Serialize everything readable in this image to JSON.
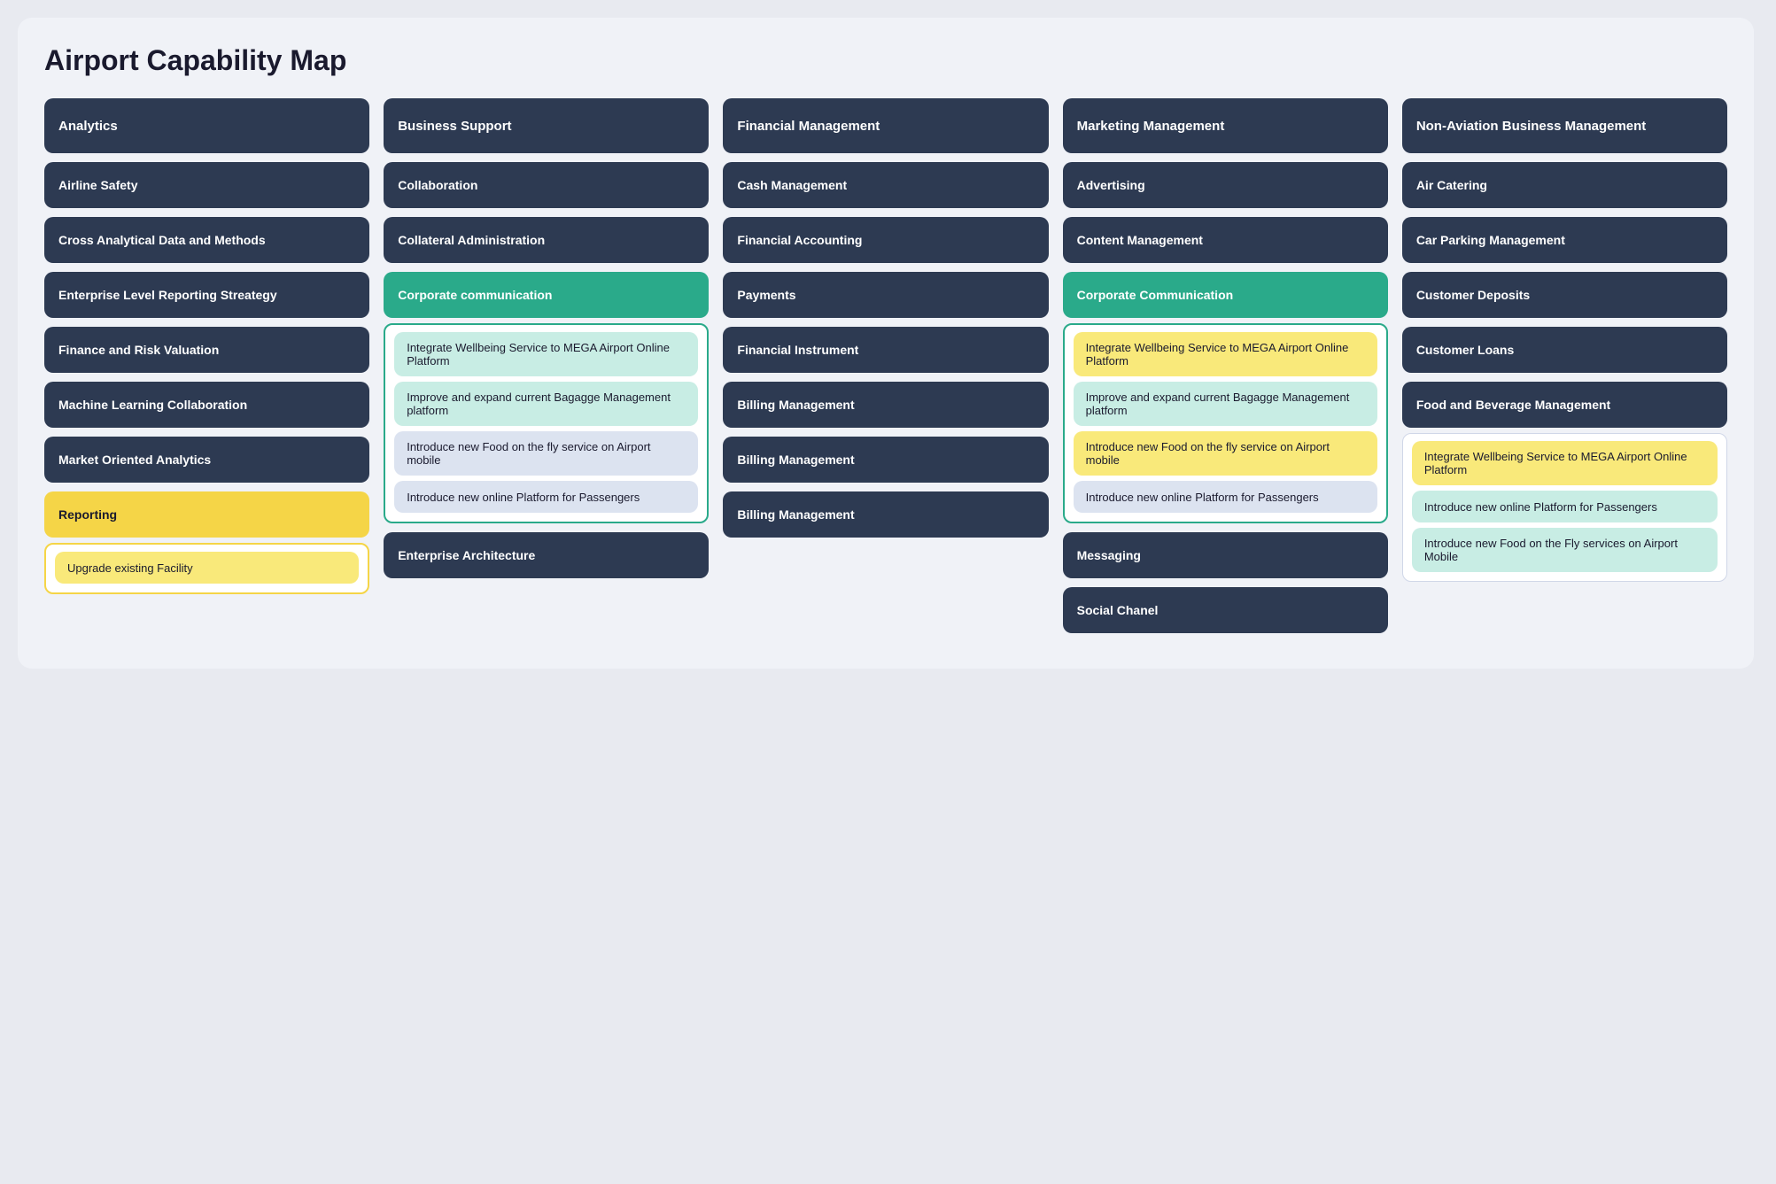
{
  "title": "Airport Capability Map",
  "columns": [
    {
      "id": "analytics",
      "header": "Analytics",
      "sections": [
        {
          "type": "card",
          "label": "Airline Safety"
        },
        {
          "type": "card",
          "label": "Cross Analytical Data and Methods"
        },
        {
          "type": "card",
          "label": "Enterprise Level Reporting Streategy"
        },
        {
          "type": "card",
          "label": "Finance and Risk Valuation"
        },
        {
          "type": "card",
          "label": "Machine Learning Collaboration"
        },
        {
          "type": "card",
          "label": "Market Oriented Analytics"
        },
        {
          "type": "group",
          "variant": "yellow",
          "label": "Reporting",
          "items": [
            {
              "variant": "light-yellow",
              "text": "Upgrade existing Facility"
            }
          ]
        }
      ]
    },
    {
      "id": "business-support",
      "header": "Business Support",
      "sections": [
        {
          "type": "card",
          "label": "Collaboration"
        },
        {
          "type": "card",
          "label": "Collateral Administration"
        },
        {
          "type": "group",
          "variant": "teal",
          "label": "Corporate communication",
          "items": [
            {
              "variant": "light-teal",
              "text": "Integrate Wellbeing Service to MEGA Airport Online Platform"
            },
            {
              "variant": "light-teal",
              "text": "Improve and expand current Bagagge Management platform"
            },
            {
              "variant": "light",
              "text": "Introduce new Food on the fly service on Airport mobile"
            },
            {
              "variant": "light",
              "text": "Introduce new online Platform for Passengers"
            }
          ]
        },
        {
          "type": "card",
          "label": "Enterprise Architecture"
        }
      ]
    },
    {
      "id": "financial-management",
      "header": "Financial Management",
      "sections": [
        {
          "type": "card",
          "label": "Cash Management"
        },
        {
          "type": "card",
          "label": "Financial Accounting"
        },
        {
          "type": "card",
          "label": "Payments"
        },
        {
          "type": "card",
          "label": "Financial Instrument"
        },
        {
          "type": "card",
          "label": "Billing Management"
        },
        {
          "type": "card",
          "label": "Billing Management"
        },
        {
          "type": "card",
          "label": "Billing Management"
        }
      ]
    },
    {
      "id": "marketing-management",
      "header": "Marketing Management",
      "sections": [
        {
          "type": "card",
          "label": "Advertising"
        },
        {
          "type": "card",
          "label": "Content Management"
        },
        {
          "type": "group",
          "variant": "teal",
          "label": "Corporate Communication",
          "items": [
            {
              "variant": "light-yellow",
              "text": "Integrate Wellbeing Service to MEGA Airport Online Platform"
            },
            {
              "variant": "light-teal",
              "text": "Improve and expand current Bagagge Management platform"
            },
            {
              "variant": "light-yellow",
              "text": "Introduce new Food on the fly service on Airport mobile"
            },
            {
              "variant": "light",
              "text": "Introduce new online Platform for Passengers"
            }
          ]
        },
        {
          "type": "card",
          "label": "Messaging"
        },
        {
          "type": "card",
          "label": "Social Chanel"
        }
      ]
    },
    {
      "id": "non-aviation",
      "header": "Non-Aviation Business Management",
      "sections": [
        {
          "type": "card",
          "label": "Air Catering"
        },
        {
          "type": "card",
          "label": "Car Parking Management"
        },
        {
          "type": "card",
          "label": "Customer Deposits"
        },
        {
          "type": "card",
          "label": "Customer Loans"
        },
        {
          "type": "group",
          "variant": "plain",
          "label": "Food and Beverage Management",
          "items": [
            {
              "variant": "light-yellow",
              "text": "Integrate Wellbeing Service to MEGA Airport Online Platform"
            },
            {
              "variant": "light-teal",
              "text": "Introduce new online Platform for Passengers"
            },
            {
              "variant": "light-teal",
              "text": "Introduce new Food on the Fly services on Airport Mobile"
            }
          ]
        }
      ]
    }
  ]
}
